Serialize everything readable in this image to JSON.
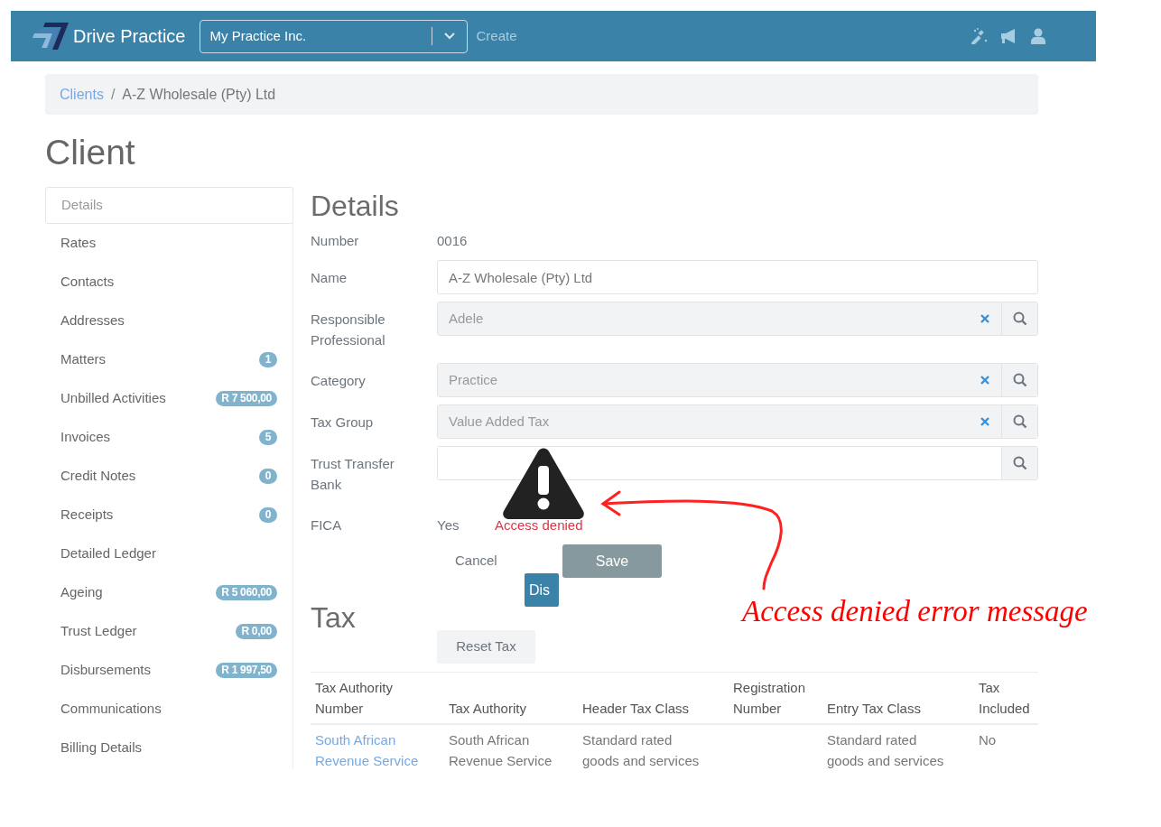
{
  "header": {
    "brand": "Drive Practice",
    "practice_select": {
      "value": "My Practice Inc."
    },
    "create_link": "Create"
  },
  "breadcrumb": {
    "separator": "/",
    "items": [
      {
        "label": "Clients",
        "kind": "link"
      },
      {
        "label": "A-Z Wholesale (Pty) Ltd",
        "kind": "current"
      }
    ]
  },
  "page_title": "Client",
  "sidebar": {
    "items": [
      {
        "label": "Details",
        "selected": true
      },
      {
        "label": "Rates",
        "selected": false
      },
      {
        "label": "Contacts",
        "selected": false
      },
      {
        "label": "Addresses",
        "selected": false
      },
      {
        "label": "Matters",
        "selected": false,
        "badge": "1"
      },
      {
        "label": "Unbilled Activities",
        "selected": false,
        "badge": "R 7 500,00"
      },
      {
        "label": "Invoices",
        "selected": false,
        "badge": "5"
      },
      {
        "label": "Credit Notes",
        "selected": false,
        "badge": "0"
      },
      {
        "label": "Receipts",
        "selected": false,
        "badge": "0"
      },
      {
        "label": "Detailed Ledger",
        "selected": false
      },
      {
        "label": "Ageing",
        "selected": false,
        "badge": "R 5 060,00"
      },
      {
        "label": "Trust Ledger",
        "selected": false,
        "badge": "R 0,00"
      },
      {
        "label": "Disbursements",
        "selected": false,
        "badge": "R 1 997,50"
      },
      {
        "label": "Communications",
        "selected": false
      },
      {
        "label": "Billing Details",
        "selected": false
      }
    ]
  },
  "details": {
    "title": "Details",
    "fields": [
      {
        "label": "Number",
        "kind": "static",
        "value": "0016"
      },
      {
        "label": "Name",
        "kind": "input",
        "value": "A-Z Wholesale (Pty) Ltd"
      },
      {
        "label": "Responsible Professional",
        "kind": "lookup",
        "value": "Adele",
        "clearable": true
      },
      {
        "label": "Category",
        "kind": "lookup",
        "value": "Practice",
        "clearable": true
      },
      {
        "label": "Tax Group",
        "kind": "lookup",
        "value": "Value Added Tax",
        "clearable": true
      },
      {
        "label": "Trust Transfer Bank",
        "kind": "lookup",
        "clearable": false
      }
    ]
  },
  "fica": {
    "label": "FICA",
    "value": "Yes",
    "error": "Access denied"
  },
  "actions": {
    "cancel": "Cancel",
    "save": "Save",
    "partial_button": "Dis"
  },
  "tax": {
    "title": "Tax",
    "reset_button": "Reset Tax",
    "table": {
      "columns": [
        {
          "label": "Tax Authority Number",
          "kind": "link"
        },
        {
          "label": "Tax Authority",
          "kind": "text"
        },
        {
          "label": "Header Tax Class",
          "kind": "text"
        },
        {
          "label": "Registration Number",
          "kind": "text"
        },
        {
          "label": "Entry Tax Class",
          "kind": "text"
        },
        {
          "label": "Tax Included",
          "kind": "text"
        }
      ],
      "rows": [
        [
          "South African Revenue Service",
          "South African Revenue Service",
          "Standard rated goods and services",
          null,
          "Standard rated goods and services",
          "No"
        ]
      ]
    }
  },
  "annotation": {
    "text": "Access denied error message"
  }
}
